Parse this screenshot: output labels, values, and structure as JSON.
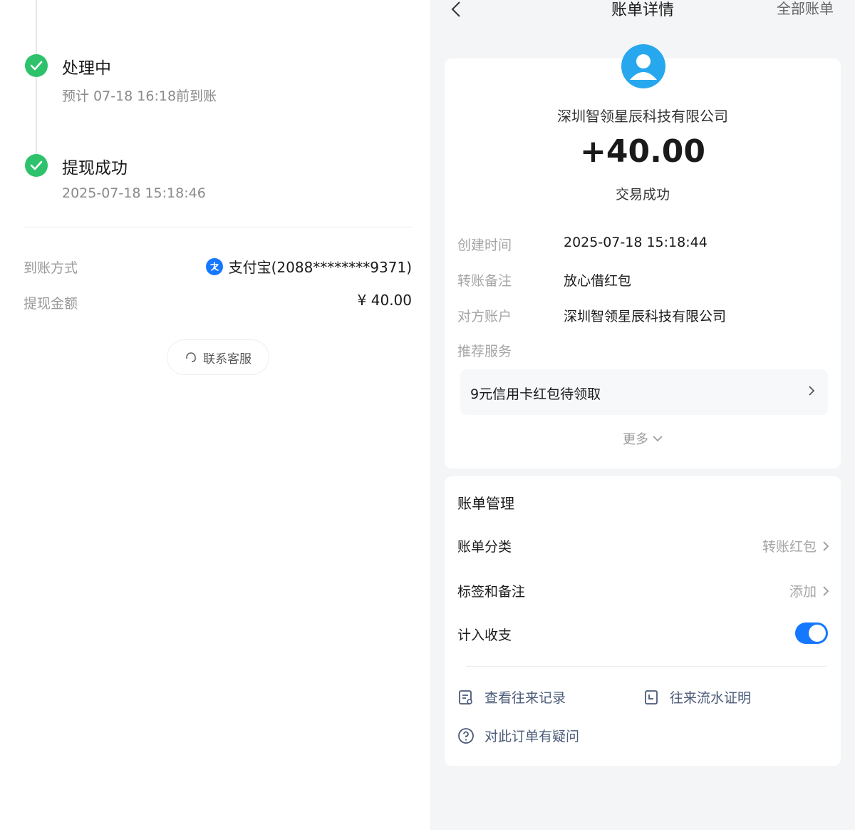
{
  "left": {
    "steps": [
      {
        "title": "处理中",
        "subtitle": "预计 07-18 16:18前到账"
      },
      {
        "title": "提现成功",
        "subtitle": "2025-07-18 15:18:46"
      }
    ],
    "rows": [
      {
        "label": "到账方式",
        "value": "支付宝(2088********9371)"
      },
      {
        "label": "提现金额",
        "value": "¥ 40.00"
      }
    ],
    "service_label": "联系客服"
  },
  "right": {
    "nav": {
      "title": "账单详情",
      "right_label": "全部账单"
    },
    "payee": "深圳智领星辰科技有限公司",
    "amount": "+40.00",
    "status": "交易成功",
    "details": [
      {
        "label": "创建时间",
        "value": "2025-07-18 15:18:44"
      },
      {
        "label": "转账备注",
        "value": "放心借红包"
      },
      {
        "label": "对方账户",
        "value": "深圳智领星辰科技有限公司"
      },
      {
        "label": "推荐服务",
        "value": ""
      }
    ],
    "promo": "9元信用卡红包待领取",
    "more_label": "更多",
    "management": {
      "title": "账单管理",
      "items": [
        {
          "label": "账单分类",
          "value": "转账红包"
        },
        {
          "label": "标签和备注",
          "value": "添加"
        },
        {
          "label": "计入收支",
          "toggle_on": true
        }
      ]
    },
    "links": [
      {
        "label": "查看往来记录"
      },
      {
        "label": "往来流水证明"
      },
      {
        "label": "对此订单有疑问"
      }
    ]
  },
  "colors": {
    "success_green": "#2dc26b",
    "accent_blue": "#1677ff",
    "avatar_blue": "#27a8ee"
  }
}
